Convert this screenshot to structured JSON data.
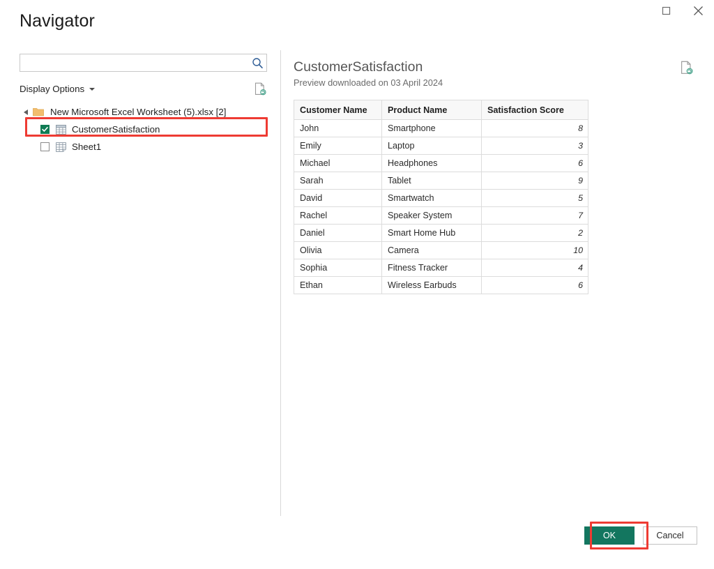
{
  "window": {
    "title": "Navigator",
    "controls": [
      {
        "name": "maximize-button",
        "icon": "maximize-icon",
        "label": ""
      },
      {
        "name": "close-button",
        "icon": "close-icon",
        "label": ""
      }
    ]
  },
  "left_pane": {
    "search": {
      "value": "",
      "placeholder": "",
      "icon": "search-icon"
    },
    "display_options": {
      "label": "Display Options",
      "caret_icon": "chevron-down-icon",
      "refresh_icon": "refresh-document-icon"
    },
    "tree": {
      "root": {
        "label": "New Microsoft Excel Worksheet (5).xlsx [2]",
        "expanded": true,
        "icon": "folder-icon",
        "expander_icon": "triangle-expanded-icon"
      },
      "children": [
        {
          "label": "CustomerSatisfaction",
          "checked": true,
          "icon": "table-icon",
          "highlighted": true
        },
        {
          "label": "Sheet1",
          "checked": false,
          "icon": "worksheet-icon",
          "highlighted": false
        }
      ]
    }
  },
  "right_pane": {
    "title": "CustomerSatisfaction",
    "subtitle": "Preview downloaded on 03 April 2024",
    "refresh_icon": "refresh-document-icon",
    "table": {
      "columns": [
        "Customer Name",
        "Product Name",
        "Satisfaction Score"
      ],
      "rows": [
        [
          "John",
          "Smartphone",
          "8"
        ],
        [
          "Emily",
          "Laptop",
          "3"
        ],
        [
          "Michael",
          "Headphones",
          "6"
        ],
        [
          "Sarah",
          "Tablet",
          "9"
        ],
        [
          "David",
          "Smartwatch",
          "5"
        ],
        [
          "Rachel",
          "Speaker System",
          "7"
        ],
        [
          "Daniel",
          "Smart Home Hub",
          "2"
        ],
        [
          "Olivia",
          "Camera",
          "10"
        ],
        [
          "Sophia",
          "Fitness Tracker",
          "4"
        ],
        [
          "Ethan",
          "Wireless Earbuds",
          "6"
        ]
      ]
    }
  },
  "footer": {
    "ok_label": "OK",
    "cancel_label": "Cancel"
  },
  "colors": {
    "accent_green": "#13765f",
    "checkbox_green": "#107c54",
    "highlight_red": "#ee3b33",
    "folder_orange": "#f0ba6a",
    "search_icon_blue": "#2f5d96"
  }
}
